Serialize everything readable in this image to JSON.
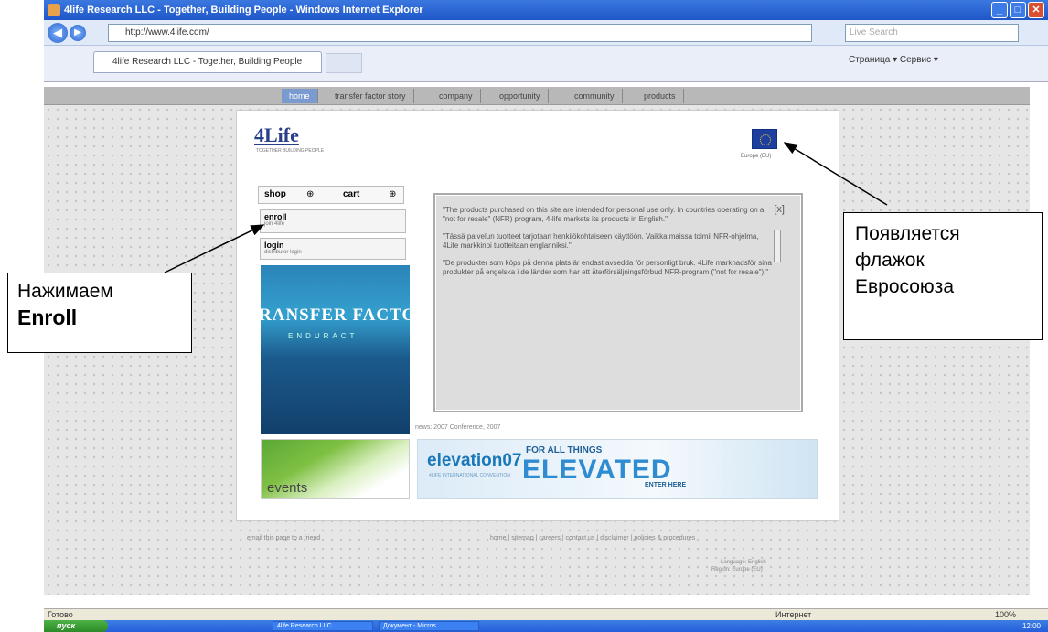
{
  "window": {
    "title": "4life Research LLC - Together, Building People - Windows Internet Explorer"
  },
  "address": {
    "url": "http://www.4life.com/",
    "search_placeholder": "Live Search"
  },
  "tab": {
    "label": "4life Research LLC - Together, Building People"
  },
  "command_bar": {
    "text": "Страница ▾  Сервис ▾"
  },
  "site_nav": [
    "home",
    "transfer factor story",
    "company",
    "opportunity",
    "community",
    "products"
  ],
  "logo": {
    "text": "4Life",
    "tagline": "TOGETHER BUILDING PEOPLE"
  },
  "eu": {
    "caption": "Europe (EU)"
  },
  "shop": {
    "label": "shop",
    "cart": "cart"
  },
  "enroll": {
    "label": "enroll",
    "sub": "join 4life"
  },
  "login": {
    "label": "login",
    "sub": "distributor login"
  },
  "promo": {
    "text": "RANSFER FACTOR",
    "sub": "ENDURACT"
  },
  "notice": {
    "close": "[x]",
    "p1": "\"The products purchased on this site are intended for personal use only. In countries operating on a \"not for resale\" (NFR) program, 4-life markets its products in English.\"",
    "p2": "\"Tässä palvelun tuotteet tarjotaan henkilökohtaiseen käyttöön. Vaikka maissa toimii NFR-ohjelma, 4Life markkinoi tuotteitaan englanniksi.\"",
    "p3": "\"De produkter som köps på denna plats är endast avsedda för personligt bruk. 4Life marknadsför sina produkter på engelska i de länder som har ett återförsäljningsförbud NFR-program (\"not for resale\").\""
  },
  "news": {
    "text": "news:  2007 Conference, 2007"
  },
  "events": {
    "label": "events"
  },
  "elevation": {
    "logo": "elevation07",
    "sub": "4LIFE INTERNATIONAL CONVENTION",
    "forall": "FOR ALL THINGS",
    "big": "ELEVATED",
    "enter": "ENTER HERE"
  },
  "footer": {
    "left": "email this page to a friend",
    "right": "home | sitemap | careers | contact us | disclaimer | policies & procedures",
    "r2": "Language: English",
    "r3": "Region: Europe (EU)"
  },
  "status": {
    "left": "Готово",
    "zone": "Интернет",
    "zoom": "100%"
  },
  "taskbar": {
    "start": "пуск",
    "task1": "4life Research LLC...",
    "task2": "Документ - Micros...",
    "clock": "12:00"
  },
  "callouts": {
    "left_line1": "Нажимаем",
    "left_line2": "Enroll",
    "right_line1": "Появляется",
    "right_line2": "флажок",
    "right_line3": "Евросоюза"
  }
}
